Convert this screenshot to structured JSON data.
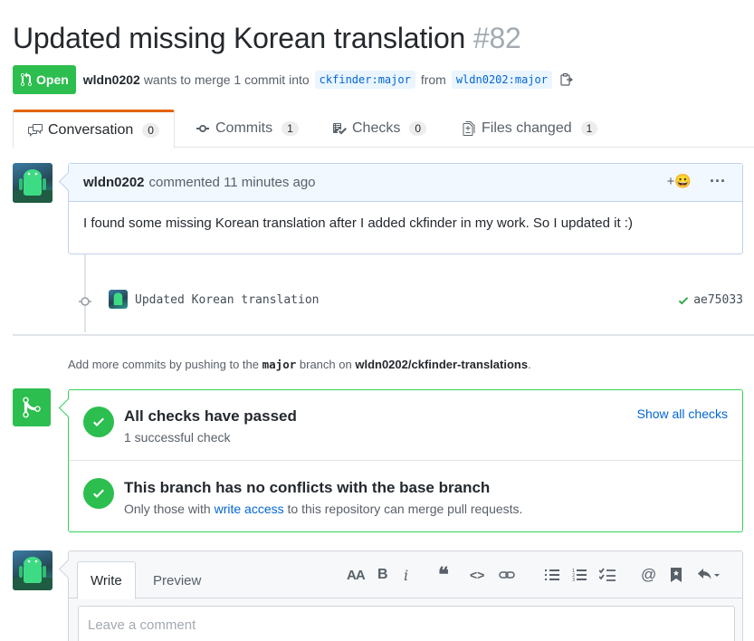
{
  "pr": {
    "title": "Updated missing Korean translation",
    "number": "#82",
    "state": "Open",
    "author": "wldn0202",
    "merge_text": "wants to merge 1 commit into",
    "base_ref": "ckfinder:major",
    "from_text": "from",
    "head_ref": "wldn0202:major"
  },
  "tabs": [
    {
      "label": "Conversation",
      "count": "0",
      "icon": "comment-discussion-icon"
    },
    {
      "label": "Commits",
      "count": "1",
      "icon": "git-commit-icon"
    },
    {
      "label": "Checks",
      "count": "0",
      "icon": "checklist-icon"
    },
    {
      "label": "Files changed",
      "count": "1",
      "icon": "file-diff-icon"
    }
  ],
  "comment": {
    "author": "wldn0202",
    "meta": "commented 11 minutes ago",
    "body": "I found some missing Korean translation after I added ckfinder in my work. So I updated it :)",
    "reaction_icon": "+😀",
    "more_icon": "···"
  },
  "commit": {
    "message": "Updated Korean translation",
    "sha": "ae75033"
  },
  "push_note": {
    "prefix": "Add more commits by pushing to the",
    "branch": "major",
    "middle": "branch on",
    "repo": "wldn0202/ckfinder-translations",
    "suffix": "."
  },
  "merge": {
    "checks_title": "All checks have passed",
    "checks_sub": "1 successful check",
    "show_all": "Show all checks",
    "conflicts_title": "This branch has no conflicts with the base branch",
    "conflicts_sub_prefix": "Only those with",
    "conflicts_sub_link": "write access",
    "conflicts_sub_suffix": "to this repository can merge pull requests."
  },
  "new_comment": {
    "write_tab": "Write",
    "preview_tab": "Preview",
    "placeholder": "Leave a comment",
    "toolbar": [
      "AA",
      "B",
      "i",
      "❝",
      "<>",
      "link",
      "ul",
      "ol",
      "tasklist",
      "@",
      "bookmark",
      "reply"
    ]
  },
  "colors": {
    "open_green": "#2cbe4e",
    "tab_accent": "#e36209",
    "link_blue": "#0366d6",
    "ref_bg": "#eaf5ff",
    "comment_header_bg": "#f1f8ff"
  }
}
